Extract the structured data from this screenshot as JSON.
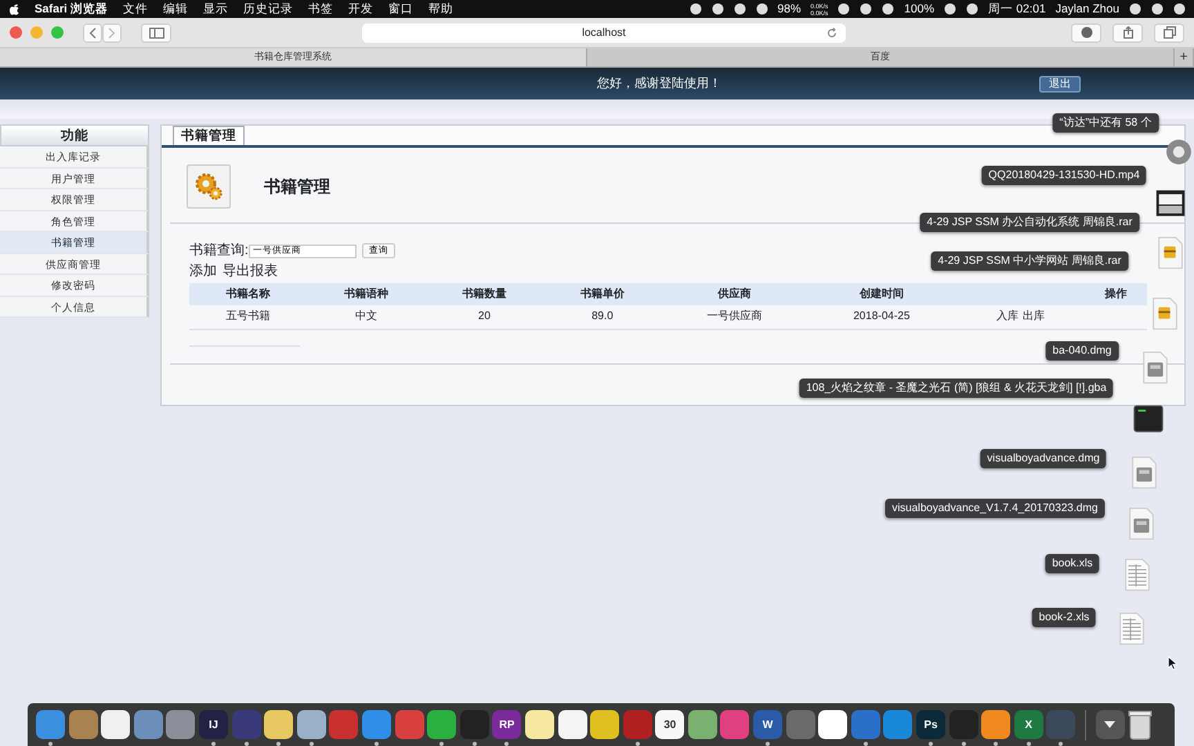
{
  "menu_bar": {
    "app": "Safari 浏览器",
    "menus": [
      "文件",
      "编辑",
      "显示",
      "历史记录",
      "书签",
      "开发",
      "窗口",
      "帮助"
    ],
    "status": [
      {
        "kind": "icon"
      },
      {
        "kind": "icon"
      },
      {
        "kind": "icon"
      },
      {
        "kind": "icon"
      },
      {
        "kind": "text",
        "text": "98%"
      },
      {
        "kind": "speed",
        "text": "0.0K/s",
        "text2": "0.0K/s"
      },
      {
        "kind": "icon"
      },
      {
        "kind": "icon"
      },
      {
        "kind": "icon"
      },
      {
        "kind": "text",
        "text": "100%"
      },
      {
        "kind": "icon"
      },
      {
        "kind": "icon"
      },
      {
        "kind": "text",
        "text": "周一 02:01"
      },
      {
        "kind": "text",
        "text": "Jaylan Zhou"
      },
      {
        "kind": "icon"
      },
      {
        "kind": "icon"
      },
      {
        "kind": "icon"
      }
    ]
  },
  "browser": {
    "url": "localhost",
    "tabs": [
      {
        "title": "书籍仓库管理系统",
        "selected": true
      },
      {
        "title": "百度",
        "selected": false
      }
    ],
    "new_tab": "+"
  },
  "app": {
    "greeting": "您好，感谢登陆使用！",
    "logout": "退出",
    "sidebar": {
      "title": "功能",
      "items": [
        {
          "label": "出入库记录",
          "selected": false
        },
        {
          "label": "用户管理",
          "selected": false
        },
        {
          "label": "权限管理",
          "selected": false
        },
        {
          "label": "角色管理",
          "selected": false
        },
        {
          "label": "书籍管理",
          "selected": true
        },
        {
          "label": "供应商管理",
          "selected": false
        },
        {
          "label": "修改密码",
          "selected": false
        },
        {
          "label": "个人信息",
          "selected": false
        }
      ]
    },
    "panel_tab": "书籍管理",
    "heading": "书籍管理",
    "search": {
      "label": "书籍查询:",
      "value": "一号供应商",
      "button": "查询"
    },
    "actions": [
      "添加",
      "导出报表"
    ],
    "table": {
      "columns": [
        {
          "label": "书籍名称"
        },
        {
          "label": "书籍语种"
        },
        {
          "label": "书籍数量"
        },
        {
          "label": "书籍单价"
        },
        {
          "label": "供应商"
        },
        {
          "label": "创建时间"
        },
        {},
        {
          "label": "操作"
        }
      ],
      "rows": [
        {
          "cells": [
            "五号书籍",
            "中文",
            "20",
            "89.0",
            "一号供应商",
            "2018-04-25"
          ],
          "links": [
            "入库",
            "出库"
          ]
        }
      ]
    }
  },
  "desktop_stack": [
    {
      "label": "“访达”中还有 58 个",
      "kind": "more"
    },
    {
      "label": "QQ20180429-131530-HD.mp4",
      "kind": "video"
    },
    {
      "label": "4-29 JSP SSM 办公自动化系统 周锦良.rar",
      "kind": "rar"
    },
    {
      "label": "4-29 JSP SSM 中小学网站 周锦良.rar",
      "kind": "rar"
    },
    {
      "label": "ba-040.dmg",
      "kind": "dmg"
    },
    {
      "label": "108_火焰之纹章 - 圣魔之光石 (简) [狼组 & 火花天龙剑] [!].gba",
      "kind": "exec"
    },
    {
      "label": "visualboyadvance.dmg",
      "kind": "dmg"
    },
    {
      "label": "visualboyadvance_V1.7.4_20170323.dmg",
      "kind": "dmg"
    },
    {
      "label": "book.xls",
      "kind": "xls"
    },
    {
      "label": "book-2.xls",
      "kind": "xls"
    }
  ],
  "dock": [
    {
      "color": "#3b8fe0",
      "running": true
    },
    {
      "color": "#a8824f",
      "running": false
    },
    {
      "color": "#f0f0f0",
      "running": false
    },
    {
      "color": "#6b8fb8",
      "running": false
    },
    {
      "color": "#8a8f99",
      "running": false
    },
    {
      "color": "#222244",
      "glyph": "IJ",
      "running": true
    },
    {
      "color": "#3a3a7a",
      "running": true
    },
    {
      "color": "#e8c860",
      "running": true
    },
    {
      "color": "#9ab0c8",
      "running": true
    },
    {
      "color": "#c83030",
      "running": false
    },
    {
      "color": "#2e8ee8",
      "running": true
    },
    {
      "color": "#d84040",
      "running": false
    },
    {
      "color": "#2ab040",
      "running": true
    },
    {
      "color": "#222222",
      "running": true
    },
    {
      "color": "#7a2a9a",
      "glyph": "RP",
      "running": true
    },
    {
      "color": "#f6e8a0",
      "running": false
    },
    {
      "color": "#f4f4f4",
      "running": false
    },
    {
      "color": "#e0c020",
      "running": false
    },
    {
      "color": "#b02020",
      "running": true
    },
    {
      "color": "#f8f8f8",
      "glyph": "30",
      "running": false
    },
    {
      "color": "#7ab070",
      "running": false
    },
    {
      "color": "#e04080",
      "running": false
    },
    {
      "color": "#2b5aa8",
      "glyph": "W",
      "running": true
    },
    {
      "color": "#6a6a6a",
      "running": false
    },
    {
      "color": "#ffffff",
      "running": false
    },
    {
      "color": "#2a70c8",
      "running": true
    },
    {
      "color": "#1a88d8",
      "running": false
    },
    {
      "color": "#0a2a3a",
      "glyph": "Ps",
      "running": true
    },
    {
      "color": "#222222",
      "running": true
    },
    {
      "color": "#f08a20",
      "running": true
    },
    {
      "color": "#1e7a40",
      "glyph": "X",
      "running": true
    },
    {
      "color": "#3a4a5a",
      "running": true
    }
  ]
}
